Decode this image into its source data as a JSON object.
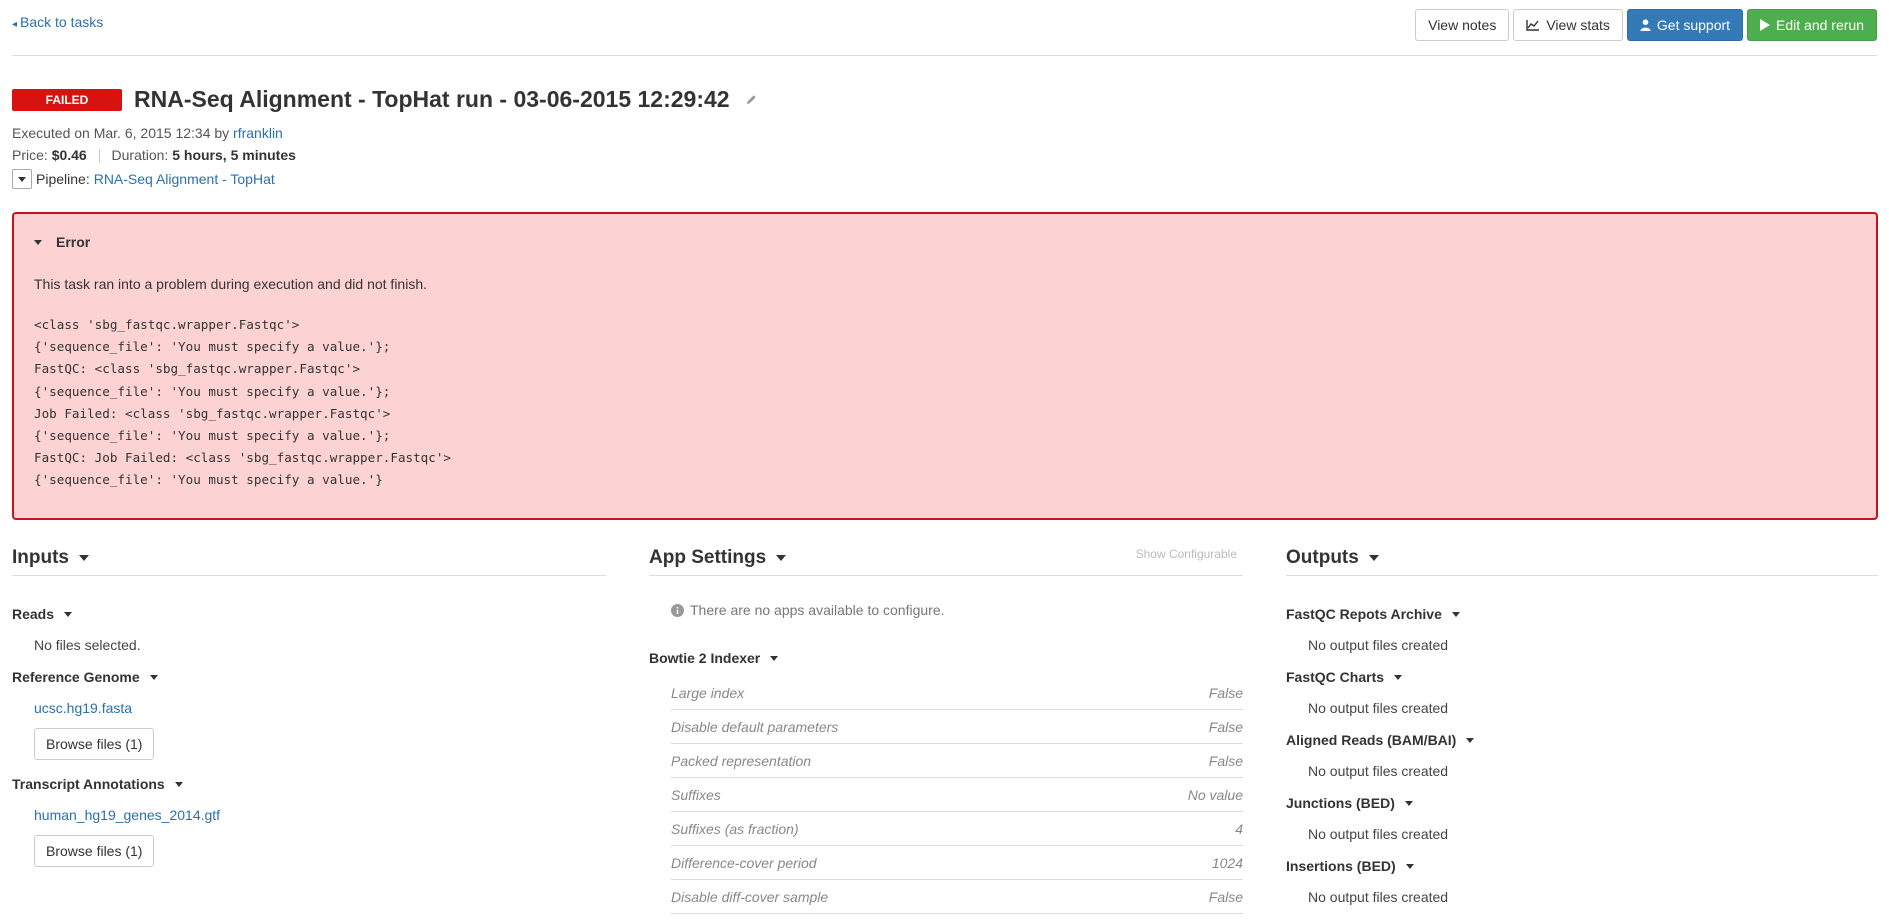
{
  "nav": {
    "back_label": "Back to tasks"
  },
  "toolbar": {
    "view_notes": "View notes",
    "view_stats": "View stats",
    "get_support": "Get support",
    "edit_rerun": "Edit and rerun"
  },
  "task": {
    "status": "FAILED",
    "title": "RNA-Seq Alignment - TopHat run - 03-06-2015 12:29:42",
    "executed_prefix": "Executed on Mar. 6, 2015 12:34 by",
    "user": "rfranklin",
    "price_label": "Price:",
    "price": "$0.46",
    "duration_label": "Duration:",
    "duration": "5 hours, 5 minutes",
    "pipeline_label": "Pipeline:",
    "pipeline": "RNA-Seq Alignment - TopHat"
  },
  "error": {
    "title": "Error",
    "message": "This task ran into a problem during execution and did not finish.",
    "lines": [
      "<class 'sbg_fastqc.wrapper.Fastqc'>",
      "{'sequence_file': 'You must specify a value.'};",
      "FastQC: <class 'sbg_fastqc.wrapper.Fastqc'>",
      "{'sequence_file': 'You must specify a value.'};",
      "Job Failed: <class 'sbg_fastqc.wrapper.Fastqc'>",
      "{'sequence_file': 'You must specify a value.'};",
      "FastQC: Job Failed: <class 'sbg_fastqc.wrapper.Fastqc'>",
      "{'sequence_file': 'You must specify a value.'}"
    ]
  },
  "inputs": {
    "title": "Inputs",
    "reads": {
      "label": "Reads",
      "value": "No files selected."
    },
    "reference": {
      "label": "Reference Genome",
      "file": "ucsc.hg19.fasta",
      "browse": "Browse files (1)"
    },
    "annotations": {
      "label": "Transcript Annotations",
      "file": "human_hg19_genes_2014.gtf",
      "browse": "Browse files (1)"
    }
  },
  "app_settings": {
    "title": "App Settings",
    "show_configurable": "Show Configurable",
    "no_apps": "There are no apps available to configure.",
    "section": "Bowtie 2 Indexer",
    "rows": [
      {
        "name": "Large index",
        "value": "False"
      },
      {
        "name": "Disable default parameters",
        "value": "False"
      },
      {
        "name": "Packed representation",
        "value": "False"
      },
      {
        "name": "Suffixes",
        "value": "No value"
      },
      {
        "name": "Suffixes (as fraction)",
        "value": "4"
      },
      {
        "name": "Difference-cover period",
        "value": "1024"
      },
      {
        "name": "Disable diff-cover sample",
        "value": "False"
      }
    ]
  },
  "outputs": {
    "title": "Outputs",
    "items": [
      {
        "label": "FastQC Repots Archive",
        "value": "No output files created"
      },
      {
        "label": "FastQC Charts",
        "value": "No output files created"
      },
      {
        "label": "Aligned Reads (BAM/BAI)",
        "value": "No output files created"
      },
      {
        "label": "Junctions (BED)",
        "value": "No output files created"
      },
      {
        "label": "Insertions (BED)",
        "value": "No output files created"
      }
    ]
  },
  "colors": {
    "failed": "#d9120f",
    "error_bg": "#fdd2d3",
    "error_border": "#c9131c",
    "primary": "#337ab7",
    "success": "#4cae4c",
    "link": "#2a6fb0"
  }
}
